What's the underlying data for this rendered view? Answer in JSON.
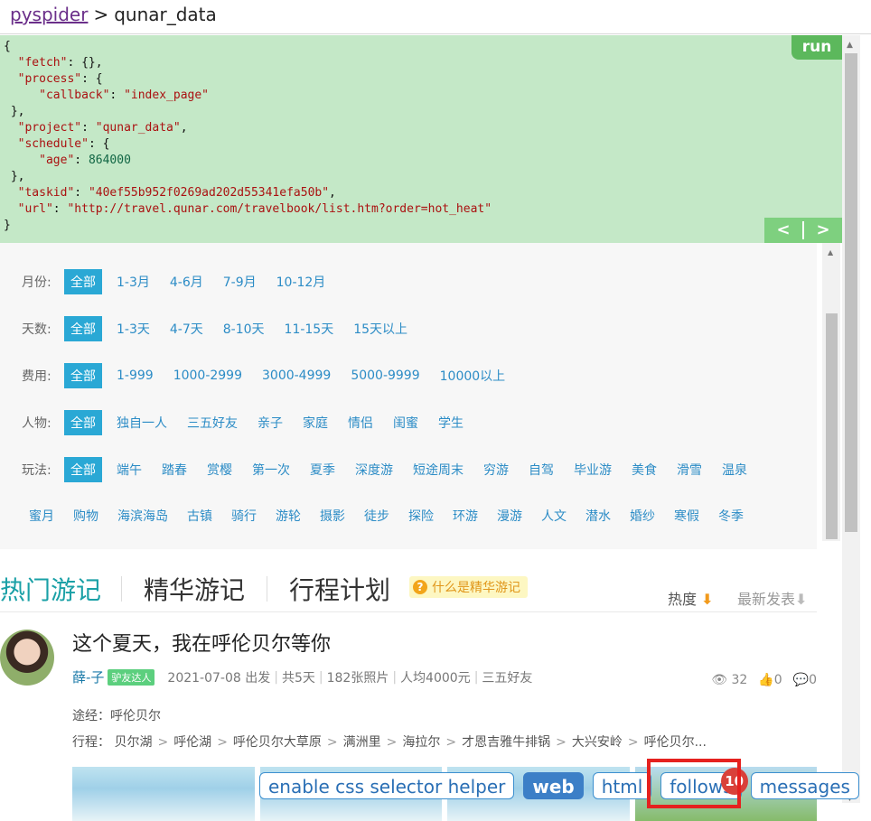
{
  "header": {
    "root": "pyspider",
    "separator": ">",
    "project": "qunar_data"
  },
  "editor": {
    "run_label": "run",
    "prev_label": "<",
    "next_label": ">",
    "lines": {
      "l1": "{",
      "fetch_key": "\"fetch\"",
      "fetch_val": ": {},",
      "process_key": "\"process\"",
      "process_val": ": {",
      "callback_key": "\"callback\"",
      "callback_val": "\"index_page\"",
      "close1": "},",
      "project_key": "\"project\"",
      "project_val": "\"qunar_data\"",
      "schedule_key": "\"schedule\"",
      "schedule_val": ": {",
      "age_key": "\"age\"",
      "age_val": "864000",
      "close2": "},",
      "taskid_key": "\"taskid\"",
      "taskid_val": "\"40ef55b952f0269ad202d55341efa50b\"",
      "url_key": "\"url\"",
      "url_val": "\"http://travel.qunar.com/travelbook/list.htm?order=hot_heat\"",
      "end": "}"
    }
  },
  "filters": {
    "month": {
      "label": "月份:",
      "options": [
        "全部",
        "1-3月",
        "4-6月",
        "7-9月",
        "10-12月"
      ]
    },
    "days": {
      "label": "天数:",
      "options": [
        "全部",
        "1-3天",
        "4-7天",
        "8-10天",
        "11-15天",
        "15天以上"
      ]
    },
    "cost": {
      "label": "费用:",
      "options": [
        "全部",
        "1-999",
        "1000-2999",
        "3000-4999",
        "5000-9999",
        "10000以上"
      ]
    },
    "people": {
      "label": "人物:",
      "options": [
        "全部",
        "独自一人",
        "三五好友",
        "亲子",
        "家庭",
        "情侣",
        "闺蜜",
        "学生"
      ]
    },
    "play": {
      "label": "玩法:",
      "options": [
        "全部",
        "端午",
        "踏春",
        "赏樱",
        "第一次",
        "夏季",
        "深度游",
        "短途周末",
        "穷游",
        "自驾",
        "毕业游",
        "美食",
        "滑雪",
        "温泉"
      ]
    },
    "play2": {
      "options": [
        "蜜月",
        "购物",
        "海滨海岛",
        "古镇",
        "骑行",
        "游轮",
        "摄影",
        "徒步",
        "探险",
        "环游",
        "漫游",
        "人文",
        "潜水",
        "婚纱",
        "寒假",
        "冬季"
      ]
    }
  },
  "tabs": [
    "热门游记",
    "精华游记",
    "行程计划"
  ],
  "help": {
    "icon": "?",
    "text": "什么是精华游记"
  },
  "sort": {
    "hot": "热度",
    "hot_arrow": "⬇",
    "new": "最新发表",
    "new_arrow": "⬇"
  },
  "card": {
    "title": "这个夏天，我在呼伦贝尔等你",
    "user": "薛-子",
    "badge": "驴友达人",
    "date": "2021-07-08 出发",
    "duration": "共5天",
    "photos": "182张照片",
    "cost": "人均4000元",
    "people": "三五好友",
    "views": "32",
    "likes": "0",
    "comments": "0",
    "via": "途经：呼伦贝尔",
    "route_label": "行程：",
    "route": [
      "贝尔湖",
      "呼伦湖",
      "呼伦贝尔大草原",
      "满洲里",
      "海拉尔",
      "才恩吉雅牛排锅",
      "大兴安岭",
      "呼伦贝尔..."
    ],
    "route_arrow": ">"
  },
  "toolbar": {
    "css_helper": "enable css selector helper",
    "web": "web",
    "html": "html",
    "follows": "follows",
    "follows_count": "10",
    "messages": "messages"
  },
  "colors": {
    "editor_bg": "#c4e8c7",
    "run": "#5cb85c",
    "accent": "#2aa8d5",
    "highlight": "#e5211f"
  }
}
